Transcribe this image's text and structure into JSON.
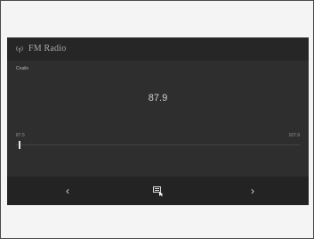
{
  "header": {
    "title": "FM Radio",
    "icon": "radio-icon"
  },
  "station": {
    "sub_label": "Cnaile",
    "frequency": "87.9"
  },
  "tuner": {
    "min_label": "87.5",
    "max_label": "107.9"
  },
  "controls": {
    "prev_label": "‹",
    "next_label": "›",
    "preset_icon": "preset-list-icon"
  },
  "colors": {
    "screen_bg": "#2e2e2e",
    "header_bg": "#262626",
    "text": "#d2d2d2"
  }
}
